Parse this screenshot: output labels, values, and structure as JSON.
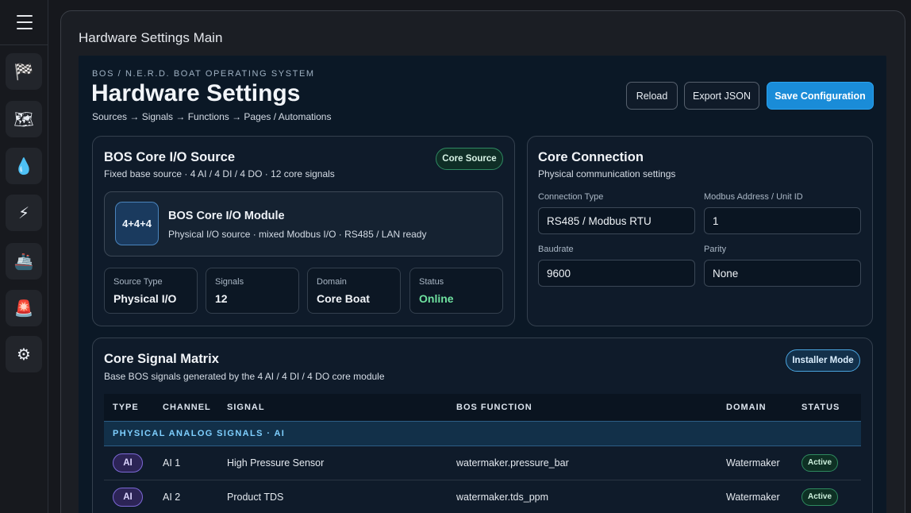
{
  "sidebar": {
    "menu_icon": "hamburger-menu-icon",
    "items": [
      {
        "icon": "checkered-flag-icon",
        "glyph": "🏁"
      },
      {
        "icon": "map-icon",
        "glyph": "🗺"
      },
      {
        "icon": "water-drop-icon",
        "glyph": "💧"
      },
      {
        "icon": "lightning-icon",
        "glyph": "⚡"
      },
      {
        "icon": "ship-icon",
        "glyph": "🚢"
      },
      {
        "icon": "alarm-light-icon",
        "glyph": "🚨"
      },
      {
        "icon": "gear-icon",
        "glyph": "⚙"
      }
    ]
  },
  "window_title": "Hardware Settings Main",
  "header": {
    "eyebrow": "BOS / N.E.R.D. BOAT OPERATING SYSTEM",
    "title": "Hardware Settings",
    "flow": "Sources → Signals → Functions → Pages / Automations",
    "buttons": {
      "reload": "Reload",
      "export": "Export JSON",
      "save": "Save Configuration"
    }
  },
  "core_source": {
    "title": "BOS Core I/O Source",
    "subtitle": "Fixed base source · 4 AI / 4 DI / 4 DO · 12 core signals",
    "badge": "Core Source",
    "module": {
      "icon_text": "4+4+4",
      "name": "BOS Core I/O Module",
      "description": "Physical I/O source · mixed Modbus I/O · RS485 / LAN ready"
    },
    "stats": [
      {
        "label": "Source Type",
        "value": "Physical I/O"
      },
      {
        "label": "Signals",
        "value": "12"
      },
      {
        "label": "Domain",
        "value": "Core Boat"
      },
      {
        "label": "Status",
        "value": "Online"
      }
    ]
  },
  "connection": {
    "title": "Core Connection",
    "subtitle": "Physical communication settings",
    "fields": [
      {
        "label": "Connection Type",
        "value": "RS485 / Modbus RTU"
      },
      {
        "label": "Modbus Address / Unit ID",
        "value": "1"
      },
      {
        "label": "Baudrate",
        "value": "9600"
      },
      {
        "label": "Parity",
        "value": "None"
      }
    ]
  },
  "matrix": {
    "title": "Core Signal Matrix",
    "subtitle": "Base BOS signals generated by the 4 AI / 4 DI / 4 DO core module",
    "badge": "Installer Mode",
    "columns": [
      "TYPE",
      "CHANNEL",
      "SIGNAL",
      "BOS FUNCTION",
      "DOMAIN",
      "STATUS"
    ],
    "group_label": "PHYSICAL ANALOG SIGNALS · AI",
    "rows": [
      {
        "type": "AI",
        "channel": "AI 1",
        "signal": "High Pressure Sensor",
        "function": "watermaker.pressure_bar",
        "domain": "Watermaker",
        "status": "Active"
      },
      {
        "type": "AI",
        "channel": "AI 2",
        "signal": "Product TDS",
        "function": "watermaker.tds_ppm",
        "domain": "Watermaker",
        "status": "Active"
      }
    ]
  }
}
